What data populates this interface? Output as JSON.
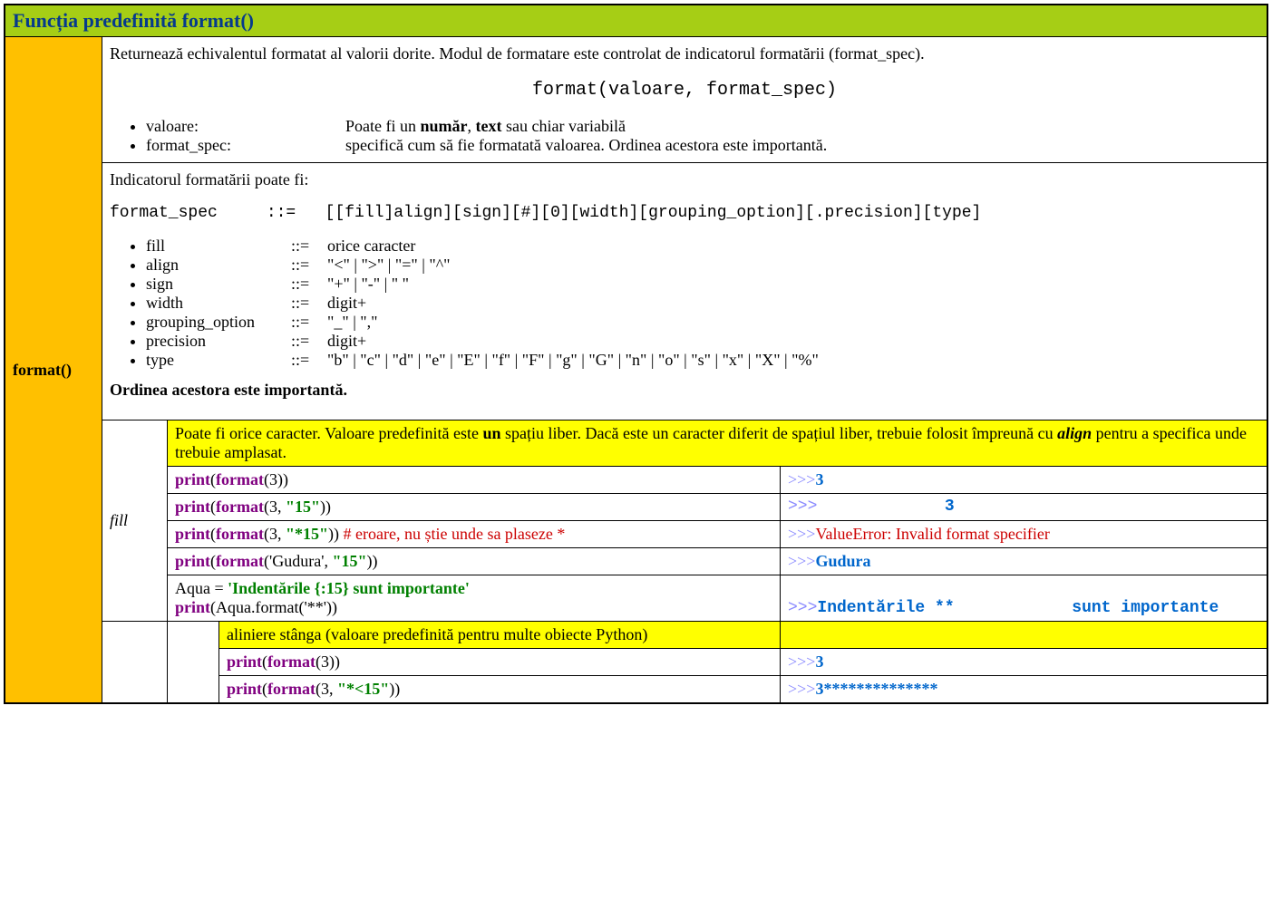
{
  "title": "Funcția predefinită format()",
  "side_label": "format()",
  "desc": {
    "intro": "Returnează echivalentul formatat al valorii dorite. Modul de formatare este controlat de indicatorul formatării (format_spec).",
    "signature": "format(valoare, format_spec)",
    "params": [
      {
        "name": "valoare:",
        "text_pre": "Poate fi un ",
        "b1": "număr",
        "mid": ", ",
        "b2": "text",
        "post": " sau chiar variabilă"
      },
      {
        "name": "format_spec:",
        "text": "specifică cum să fie formatată valoarea. Ordinea acestora este importantă."
      }
    ]
  },
  "spec": {
    "intro": "Indicatorul formatării poate fi:",
    "line": "format_spec     ::=   [[fill]align][sign][#][0][width][grouping_option][.precision][type]",
    "rules": [
      {
        "name": "fill",
        "op": "::=",
        "val": "orice caracter"
      },
      {
        "name": "align",
        "op": "::=",
        "val": "\"<\" | \">\" | \"=\" | \"^\""
      },
      {
        "name": "sign",
        "op": "::=",
        "val": "\"+\" | \"-\" | \" \""
      },
      {
        "name": "width",
        "op": "::=",
        "val": "digit+"
      },
      {
        "name": "grouping_option",
        "op": "::=",
        "val": "\"_\" | \",\""
      },
      {
        "name": "precision",
        "op": "::=",
        "val": "digit+"
      },
      {
        "name": "type",
        "op": "::=",
        "val": "\"b\" | \"c\" | \"d\" | \"e\" | \"E\" | \"f\" | \"F\" | \"g\" | \"G\" | \"n\" | \"o\" | \"s\" | \"x\" | \"X\" | \"%\""
      }
    ],
    "order_note": "Ordinea acestora este importantă."
  },
  "fill": {
    "label": "fill",
    "desc_pre": "Poate fi orice caracter. Valoare predefinită este ",
    "desc_b1": "un",
    "desc_mid": " spațiu liber. Dacă este un caracter diferit de spațiul liber, trebuie folosit împreună cu ",
    "desc_b2": "align",
    "desc_post": " pentru a specifica unde trebuie amplasat.",
    "rows": [
      {
        "print": "print",
        "fmt": "format",
        "args_plain": "3",
        "arg_str": "",
        "comment": "",
        "out_prompt": ">>>",
        "out": "3",
        "out_class": "blue"
      },
      {
        "print": "print",
        "fmt": "format",
        "args_plain": "3, ",
        "arg_str": "\"15\"",
        "comment": "",
        "out_prompt": ">>>",
        "out_pad": "             ",
        "out": "3",
        "out_class": "blue"
      },
      {
        "print": "print",
        "fmt": "format",
        "args_plain": "3, ",
        "arg_str": "\"*15\"",
        "comment": "   # eroare, nu știe unde sa plaseze *",
        "out_prompt": ">>>",
        "out": "ValueError: Invalid format specifier",
        "out_class": "red"
      },
      {
        "print": "print",
        "fmt": "format",
        "args_plain": "'Gudura', ",
        "arg_str": "\"15\"",
        "comment": "",
        "out_prompt": ">>>",
        "out": "Gudura",
        "out_class": "blue"
      }
    ],
    "multi": {
      "var": "Aqua = ",
      "str": "'Indentările {:15} sunt importante'",
      "call_print": "print",
      "call_arg": "Aqua.format('**')",
      "out_prompt": ">>>",
      "out_a": "Indentările **",
      "out_pad": "            ",
      "out_b": "sunt importante"
    }
  },
  "align_left": {
    "desc": "aliniere stânga (valoare predefinită pentru multe obiecte Python)",
    "rows": [
      {
        "print": "print",
        "fmt": "format",
        "args_plain": "3",
        "arg_str": "",
        "out_prompt": ">>>",
        "out": "3"
      },
      {
        "print": "print",
        "fmt": "format",
        "args_plain": "3, ",
        "arg_str": "\"*<15\"",
        "out_prompt": ">>>",
        "out": "3**************"
      }
    ]
  }
}
